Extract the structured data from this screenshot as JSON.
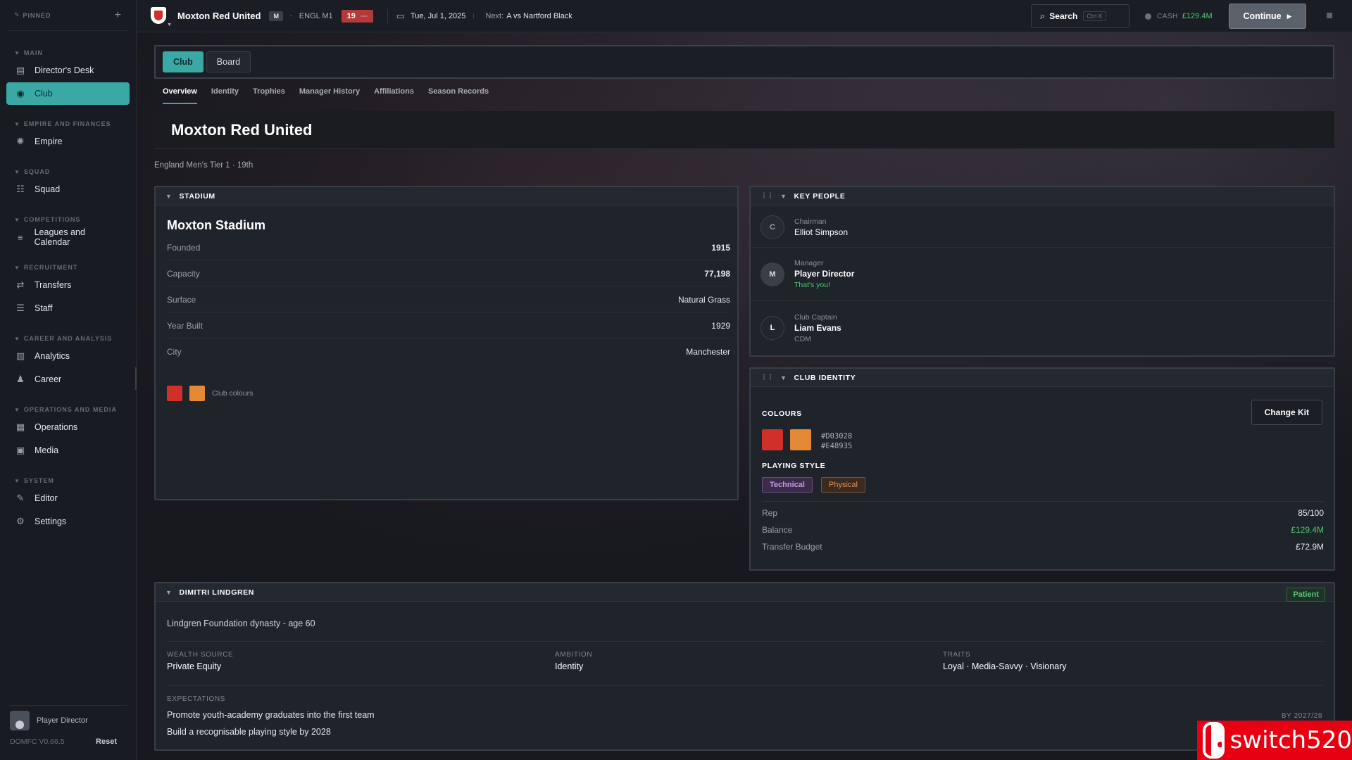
{
  "sidebar": {
    "pinned_label": "PINNED",
    "sections": [
      {
        "title": "MAIN",
        "items": [
          {
            "label": "Director's Desk",
            "icon": "clipboard-icon"
          },
          {
            "label": "Club",
            "icon": "pin-icon",
            "active": true
          }
        ]
      },
      {
        "title": "EMPIRE AND FINANCES",
        "items": [
          {
            "label": "Empire",
            "icon": "gear-icon"
          }
        ]
      },
      {
        "title": "SQUAD",
        "items": [
          {
            "label": "Squad",
            "icon": "people-icon"
          }
        ]
      },
      {
        "title": "COMPETITIONS",
        "items": [
          {
            "label": "Leagues and Calendar",
            "icon": "list-icon"
          }
        ]
      },
      {
        "title": "RECRUITMENT",
        "items": [
          {
            "label": "Transfers",
            "icon": "swap-icon"
          },
          {
            "label": "Staff",
            "icon": "staff-icon"
          }
        ]
      },
      {
        "title": "CAREER AND ANALYSIS",
        "items": [
          {
            "label": "Analytics",
            "icon": "bar-chart-icon"
          },
          {
            "label": "Career",
            "icon": "person-icon"
          }
        ]
      },
      {
        "title": "OPERATIONS AND MEDIA",
        "items": [
          {
            "label": "Operations",
            "icon": "building-icon"
          },
          {
            "label": "Media",
            "icon": "newspaper-icon"
          }
        ]
      },
      {
        "title": "SYSTEM",
        "items": [
          {
            "label": "Editor",
            "icon": "pencil-icon"
          },
          {
            "label": "Settings",
            "icon": "cog-icon"
          }
        ]
      }
    ],
    "user_name": "Player Director",
    "version": "DOMFC V0.66.5",
    "reset_label": "Reset"
  },
  "topbar": {
    "club": "Moxton Red United",
    "badge": "M",
    "league": "ENGL M1",
    "position": "19",
    "date": "Tue, Jul 1, 2025",
    "next_label": "Next:",
    "next_value": "A  vs Nartford Black",
    "search_label": "Search",
    "search_shortcut": "Ctrl K",
    "cash_label": "CASH",
    "cash_value": "£129.4M",
    "continue_label": "Continue"
  },
  "tabs": [
    "Club",
    "Board"
  ],
  "subtabs": [
    "Overview",
    "Identity",
    "Trophies",
    "Manager History",
    "Affiliations",
    "Season Records"
  ],
  "page": {
    "title": "Moxton Red United",
    "subtitle": "England Men's Tier 1 · 19th"
  },
  "stadium": {
    "header": "STADIUM",
    "name": "Moxton Stadium",
    "rows": [
      {
        "k": "Founded",
        "v": "1915"
      },
      {
        "k": "Capacity",
        "v": "77,198"
      },
      {
        "k": "Surface",
        "v": "Natural Grass"
      },
      {
        "k": "Year Built",
        "v": "1929"
      },
      {
        "k": "City",
        "v": "Manchester"
      }
    ],
    "colours_label": "Club colours"
  },
  "key_people": {
    "header": "KEY PEOPLE",
    "people": [
      {
        "initial": "C",
        "role": "Chairman",
        "name": "Elliot Simpson",
        "extra": ""
      },
      {
        "initial": "M",
        "role": "Manager",
        "name": "Player Director",
        "extra": "That's you!"
      },
      {
        "initial": "L",
        "role": "Club Captain",
        "name": "Liam Evans",
        "extra": "CDM"
      }
    ]
  },
  "club_identity": {
    "header": "CLUB IDENTITY",
    "colours_label": "COLOURS",
    "change_kit": "Change Kit",
    "primary_hex": "#D03028",
    "secondary_hex": "#E48935",
    "playing_style_label": "PLAYING STYLE",
    "styles": [
      "Technical",
      "Physical"
    ],
    "stats": [
      {
        "k": "Rep",
        "v": "85/100"
      },
      {
        "k": "Balance",
        "v": "£129.4M"
      },
      {
        "k": "Transfer Budget",
        "v": "£72.9M"
      }
    ]
  },
  "owner": {
    "header": "DIMITRI LINDGREN",
    "badge": "Patient",
    "description": "Lindgren Foundation dynasty - age 60",
    "wealth_label": "WEALTH SOURCE",
    "wealth": "Private Equity",
    "ambition_label": "AMBITION",
    "ambition": "Identity",
    "traits_label": "TRAITS",
    "traits": "Loyal · Media-Savvy · Visionary",
    "expectations_label": "EXPECTATIONS",
    "expectations": [
      "Promote youth-academy graduates into the first team",
      "Build a recognisable playing style by 2028"
    ],
    "by_label": "BY 2027/28"
  },
  "watermark": "switch520",
  "colors": {
    "accent": "#3aa9a6",
    "primary": "#D03028",
    "secondary": "#E48935",
    "cash_green": "#4cc870"
  }
}
